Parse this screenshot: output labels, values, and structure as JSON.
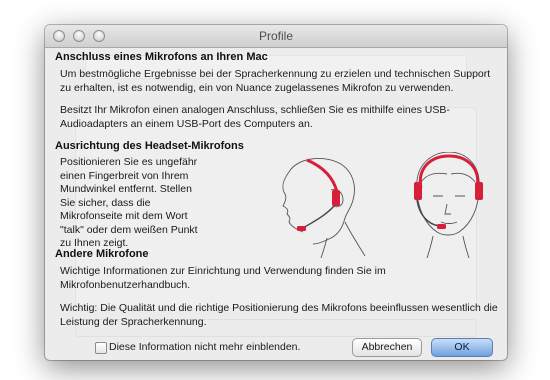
{
  "window": {
    "title": "Profile"
  },
  "sections": {
    "connect": {
      "heading": "Anschluss eines Mikrofons an Ihren Mac",
      "para1": "Um bestmögliche Ergebnisse bei der Spracherkennung zu erzielen und technischen Support zu erhalten, ist es notwendig, ein von Nuance zugelassenes Mikrofon zu verwenden.",
      "para2": "Besitzt Ihr Mikrofon einen analogen Anschluss, schließen Sie es mithilfe eines USB-Audioadapters an einem USB-Port des Computers an."
    },
    "headset": {
      "heading": "Ausrichtung des Headset-Mikrofons",
      "text": "Positionieren Sie es ungefähr einen Fingerbreit von Ihrem Mundwinkel entfernt. Stellen Sie sicher, dass die Mikrofonseite mit dem Wort \"talk\" oder dem weißen Punkt zu Ihnen zeigt."
    },
    "other": {
      "heading": "Andere Mikrofone",
      "para1": "Wichtige Informationen zur Einrichtung und Verwendung finden Sie im Mikrofonbenutzerhandbuch.",
      "para2": "Wichtig: Die Qualität und die richtige Positionierung des Mikrofons beeinflussen wesentlich die Leistung der Spracherkennung."
    }
  },
  "footer": {
    "checkbox_label": "Diese Information nicht mehr einblenden.",
    "checkbox_checked": false,
    "cancel_label": "Abbrechen",
    "ok_label": "OK"
  },
  "colors": {
    "headset_accent": "#d81f3a",
    "ok_button": "#6fa1e0"
  },
  "icons": [
    "window-close-icon",
    "window-minimize-icon",
    "window-zoom-icon",
    "headset-illustration"
  ]
}
